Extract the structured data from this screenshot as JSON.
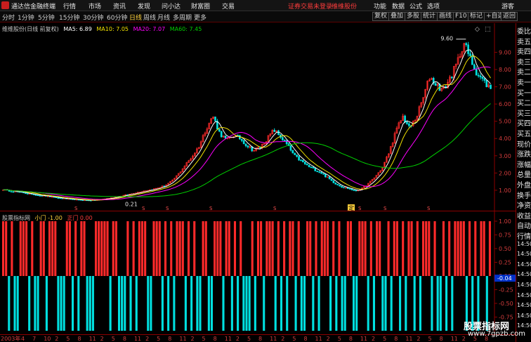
{
  "titlebar": {
    "app_title": "通达信金融终端",
    "menus": [
      "行情",
      "市场",
      "资讯",
      "发现",
      "问小达",
      "财富圈",
      "交易"
    ],
    "notice": "证券交易未登录",
    "stock_link": "维维股份",
    "right_menus": [
      "功能",
      "数据",
      "公式",
      "选项"
    ],
    "user": "游客"
  },
  "periods": [
    "分时",
    "1分钟",
    "5分钟",
    "15分钟",
    "30分钟",
    "60分钟",
    "日线",
    "周线",
    "月线",
    "多周期",
    "更多"
  ],
  "active_period": "日线",
  "toolbar_buttons": [
    "复权",
    "叠加",
    "多股",
    "统计",
    "画线",
    "F10",
    "标记",
    "+自选",
    "返回"
  ],
  "stock_info": {
    "name": "维维股份(日线 前复权)",
    "ma5": "MA5: 6.89",
    "ma10": "MA10: 7.05",
    "ma20": "MA20: 7.07",
    "ma60": "MA60: 7.45"
  },
  "colors": {
    "up": "#ff2a2a",
    "down": "#00e0e0",
    "ma5": "#ffffff",
    "ma10": "#f0e000",
    "ma20": "#ff00ff",
    "ma60": "#00d000",
    "grid": "#8c0000",
    "axis_text": "#d23c3c"
  },
  "chart_data": [
    {
      "type": "candlestick",
      "title": "维维股份(日线 前复权)",
      "y_axis_ticks": [
        "9.00",
        "8.00",
        "7.00",
        "6.00",
        "5.00",
        "4.00",
        "3.00",
        "2.00",
        "1.00"
      ],
      "ylim": [
        0.1,
        10.2
      ],
      "annotations": {
        "max_label": "9.60",
        "min_label": "0.21"
      },
      "markers": [
        "S",
        "S",
        "S",
        "S",
        "S",
        "S",
        "S",
        "S",
        "S"
      ],
      "highlight_marker": "定",
      "close_series": [
        1.05,
        0.95,
        0.92,
        0.85,
        0.78,
        0.72,
        0.68,
        0.62,
        0.56,
        0.52,
        0.48,
        0.45,
        0.43,
        0.42,
        0.45,
        0.5,
        0.56,
        0.64,
        0.72,
        0.8,
        0.9,
        0.98,
        1.05,
        1.15,
        1.3,
        1.55,
        2.0,
        2.5,
        3.0,
        3.6,
        4.6,
        5.3,
        4.3,
        3.9,
        4.2,
        4.0,
        3.6,
        3.3,
        3.5,
        4.0,
        4.5,
        4.1,
        3.6,
        3.0,
        2.7,
        2.4,
        2.2,
        2.0,
        1.7,
        1.4,
        1.2,
        1.1,
        0.95,
        1.1,
        1.4,
        1.8,
        2.3,
        3.2,
        4.4,
        5.3,
        4.6,
        5.2,
        6.3,
        7.6,
        7.1,
        6.8,
        7.5,
        8.3,
        9.6,
        8.6,
        7.8,
        7.3,
        6.9
      ]
    },
    {
      "type": "bar",
      "title": "股票指标网",
      "series": [
        {
          "name": "小门",
          "value_label": "-1.00"
        },
        {
          "name": "正门",
          "value_label": "0.00"
        }
      ],
      "y_axis_ticks": [
        "1.00",
        "0.75",
        "0.50",
        "0.25",
        "0.00",
        "-0.25",
        "-0.50",
        "-0.75"
      ],
      "ylim": [
        -1,
        1
      ],
      "current_value": "-0.04",
      "signal_bits": "1101001110100110111000110101100011111011000101011100111010101110101001100111011010100010110111010101101001101011101010011001110101100101101011010111010010101111010101101"
    }
  ],
  "x_axis": {
    "year_label": "2003年",
    "ticks": [
      "4",
      "7",
      "10",
      "2",
      "5",
      "8",
      "11",
      "2",
      "5",
      "8",
      "11",
      "2",
      "5",
      "8",
      "11",
      "2",
      "5",
      "8",
      "11",
      "2",
      "5",
      "8",
      "11",
      "2",
      "5",
      "8",
      "11",
      "2",
      "5",
      "8",
      "11",
      "2",
      "5",
      "8",
      "11",
      "2",
      "5",
      "8",
      "11",
      "2",
      "5",
      "8"
    ]
  },
  "right_panel": {
    "labels": [
      "委比",
      "卖五",
      "卖四",
      "卖三",
      "卖二",
      "卖一",
      "买一",
      "买二",
      "买三",
      "买四",
      "买五",
      "现价",
      "涨跌",
      "涨幅",
      "总量",
      "外盘",
      "换手",
      "净资",
      "收益",
      "自动",
      "行情",
      "14:50",
      "14:50",
      "14:50",
      "14:50",
      "14:50",
      "14:50",
      "14:50",
      "14:50",
      "14:50"
    ]
  },
  "watermark": {
    "title": "股票指标网",
    "url": "www.7gpzb.com"
  }
}
